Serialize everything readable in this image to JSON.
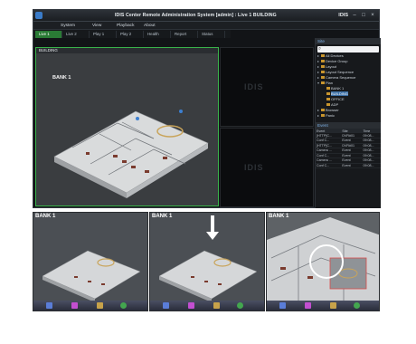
{
  "window": {
    "title": "IDIS Center Remote Administration System [admin] : Live 1  BUILDING",
    "brand": "IDIS"
  },
  "menu": [
    "System",
    "View",
    "Playback",
    "About"
  ],
  "tabs": [
    "Live 1",
    "Live 2",
    "Play 1",
    "Play 2",
    "Health",
    "Report",
    "Status"
  ],
  "camera": {
    "header": "BUILDING",
    "bank_label": "BANK 1",
    "watermark": "IDIS"
  },
  "site_panel": {
    "title": "Site",
    "tree": [
      {
        "label": "All Devices",
        "indent": 0,
        "arrow": "▸"
      },
      {
        "label": "Device Group",
        "indent": 0,
        "arrow": "▸"
      },
      {
        "label": "Layout",
        "indent": 0,
        "arrow": "▸"
      },
      {
        "label": "Layout Sequence",
        "indent": 0,
        "arrow": "▸"
      },
      {
        "label": "Camera Sequence",
        "indent": 0,
        "arrow": "▸"
      },
      {
        "label": "Plan",
        "indent": 0,
        "arrow": "▾"
      },
      {
        "label": "BANK 1",
        "indent": 1,
        "arrow": ""
      },
      {
        "label": "BUILDING",
        "indent": 1,
        "arrow": "",
        "selected": true
      },
      {
        "label": "OFFICE",
        "indent": 1,
        "arrow": ""
      },
      {
        "label": "ADP",
        "indent": 1,
        "arrow": ""
      },
      {
        "label": "Browser",
        "indent": 0,
        "arrow": "▸"
      },
      {
        "label": "Panic",
        "indent": 0,
        "arrow": "▸"
      }
    ]
  },
  "event_panel": {
    "title": "Event",
    "columns": [
      "Event",
      "Site",
      "Time"
    ],
    "rows": [
      [
        "[HTTP]C...",
        "DVR#01",
        "09:08..."
      ],
      [
        "Conf C...",
        "Event",
        "09:08..."
      ],
      [
        "[HTTP]C...",
        "DVR#01",
        "09:08..."
      ],
      [
        "Camera ...",
        "Event",
        "09:08..."
      ],
      [
        "Conf C...",
        "Event",
        "09:08..."
      ],
      [
        "Camera ...",
        "Event",
        "09:08..."
      ],
      [
        "Conf C...",
        "Event",
        "09:08..."
      ]
    ]
  },
  "bottom_views": [
    {
      "label": "BANK 1"
    },
    {
      "label": "BANK 1"
    },
    {
      "label": "BANK 1"
    }
  ],
  "colors": {
    "active_tab": "#2a7a35",
    "selected_border": "#39b34a",
    "accent": "#3a6ea5"
  }
}
